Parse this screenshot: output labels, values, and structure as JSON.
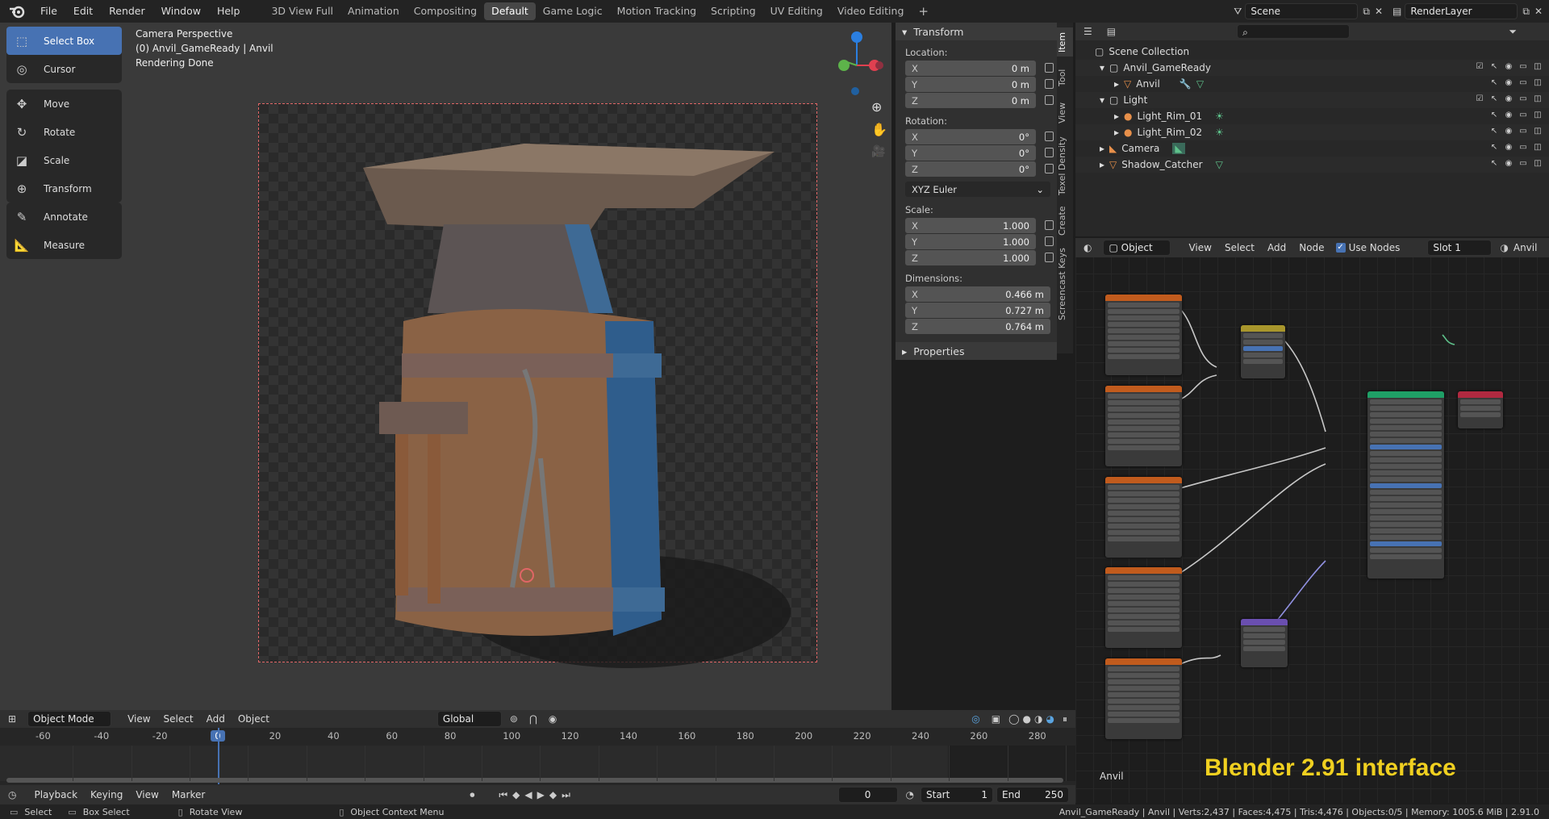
{
  "menu": [
    "File",
    "Edit",
    "Render",
    "Window",
    "Help"
  ],
  "workspaces": [
    "3D View Full",
    "Animation",
    "Compositing",
    "Default",
    "Game Logic",
    "Motion Tracking",
    "Scripting",
    "UV Editing",
    "Video Editing"
  ],
  "active_workspace": "Default",
  "scene": {
    "name": "Scene",
    "render_layer": "RenderLayer"
  },
  "tools": [
    "Select Box",
    "Cursor",
    "Move",
    "Rotate",
    "Scale",
    "Transform",
    "Annotate",
    "Measure"
  ],
  "viewport_info": {
    "line1": "Camera Perspective",
    "line2": "(0) Anvil_GameReady | Anvil",
    "line3": "Rendering Done"
  },
  "transform": {
    "title": "Transform",
    "location_label": "Location:",
    "location": [
      {
        "axis": "X",
        "value": "0 m"
      },
      {
        "axis": "Y",
        "value": "0 m"
      },
      {
        "axis": "Z",
        "value": "0 m"
      }
    ],
    "rotation_label": "Rotation:",
    "rotation": [
      {
        "axis": "X",
        "value": "0°"
      },
      {
        "axis": "Y",
        "value": "0°"
      },
      {
        "axis": "Z",
        "value": "0°"
      }
    ],
    "rotation_mode": "XYZ Euler",
    "scale_label": "Scale:",
    "scale": [
      {
        "axis": "X",
        "value": "1.000"
      },
      {
        "axis": "Y",
        "value": "1.000"
      },
      {
        "axis": "Z",
        "value": "1.000"
      }
    ],
    "dimensions_label": "Dimensions:",
    "dimensions": [
      {
        "axis": "X",
        "value": "0.466 m"
      },
      {
        "axis": "Y",
        "value": "0.727 m"
      },
      {
        "axis": "Z",
        "value": "0.764 m"
      }
    ],
    "properties": "Properties"
  },
  "side_tabs": [
    "Item",
    "Tool",
    "View",
    "Texel Density",
    "Create",
    "Screencast Keys"
  ],
  "outliner": {
    "root": "Scene Collection",
    "rows": [
      {
        "label": "Anvil_GameReady",
        "indent": 1
      },
      {
        "label": "Anvil",
        "indent": 2
      },
      {
        "label": "Light",
        "indent": 1
      },
      {
        "label": "Light_Rim_01",
        "indent": 2
      },
      {
        "label": "Light_Rim_02",
        "indent": 2
      },
      {
        "label": "Camera",
        "indent": 1
      },
      {
        "label": "Shadow_Catcher",
        "indent": 1
      }
    ]
  },
  "node_header": {
    "mode": "Object",
    "menus": [
      "View",
      "Select",
      "Add",
      "Node"
    ],
    "use_nodes": "Use Nodes",
    "slot": "Slot 1",
    "material": "Anvil"
  },
  "node_editor_label": "Anvil",
  "overlay_caption": "Blender 2.91 interface",
  "viewport_header": {
    "mode": "Object Mode",
    "menus": [
      "View",
      "Select",
      "Add",
      "Object"
    ],
    "orientation": "Global"
  },
  "timeline": {
    "ticks": [
      "-60",
      "-40",
      "-20",
      "0",
      "20",
      "40",
      "60",
      "80",
      "100",
      "120",
      "140",
      "160",
      "180",
      "200",
      "220",
      "240",
      "260",
      "280"
    ],
    "current_frame": "0",
    "start_label": "Start",
    "start": "1",
    "end_label": "End",
    "end": "250",
    "menus": [
      "Playback",
      "Keying",
      "View",
      "Marker"
    ]
  },
  "status": {
    "select": "Select",
    "box_select": "Box Select",
    "rotate_view": "Rotate View",
    "context_menu": "Object Context Menu",
    "info": "Anvil_GameReady | Anvil | Verts:2,437 | Faces:4,475 | Tris:4,476 | Objects:0/5 | Memory: 1005.6 MiB | 2.91.0"
  }
}
